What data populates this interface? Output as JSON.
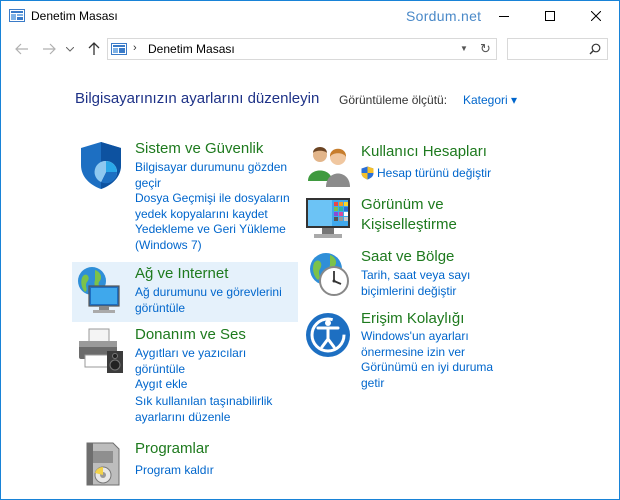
{
  "window": {
    "title": "Denetim Masası",
    "watermark": "Sordum.net"
  },
  "address": {
    "crumb": "Denetim Masası",
    "search_placeholder": ""
  },
  "header": {
    "title": "Bilgisayarınızın ayarlarını düzenleyin",
    "view_label": "Görüntüleme ölçütü:",
    "view_value": "Kategori ▾"
  },
  "categories": {
    "system": {
      "title": "Sistem ve Güvenlik",
      "links": [
        "Bilgisayar durumunu gözden",
        "geçir",
        "Dosya Geçmişi ile dosyaların",
        "yedek kopyalarını kaydet",
        "Yedekleme ve Geri Yükleme",
        "(Windows 7)"
      ]
    },
    "network": {
      "title": "Ağ ve Internet",
      "links": [
        "Ağ durumunu ve görevlerini",
        "görüntüle"
      ]
    },
    "hardware": {
      "title": "Donanım ve Ses",
      "links": [
        "Aygıtları ve yazıcıları",
        "görüntüle",
        "Aygıt ekle",
        "Sık kullanılan taşınabilirlik",
        "ayarlarını düzenle"
      ]
    },
    "programs": {
      "title": "Programlar",
      "links": [
        "Program kaldır"
      ]
    },
    "users": {
      "title": "Kullanıcı Hesapları",
      "links": [
        "Hesap türünü değiştir"
      ]
    },
    "appearance": {
      "title_line1": "Görünüm ve",
      "title_line2": "Kişiselleştirme"
    },
    "clock": {
      "title": "Saat ve Bölge",
      "links": [
        "Tarih, saat veya sayı",
        "biçimlerini değiştir"
      ]
    },
    "ease": {
      "title": "Erişim Kolaylığı",
      "links": [
        "Windows'un ayarları",
        "önermesine izin ver",
        "Görünümü en iyi duruma",
        "getir"
      ]
    }
  },
  "colors": {
    "category_title": "#1e7a1e",
    "link": "#0066cc",
    "page_title": "#1e3287",
    "hover_highlight": "#e5f1fb"
  }
}
